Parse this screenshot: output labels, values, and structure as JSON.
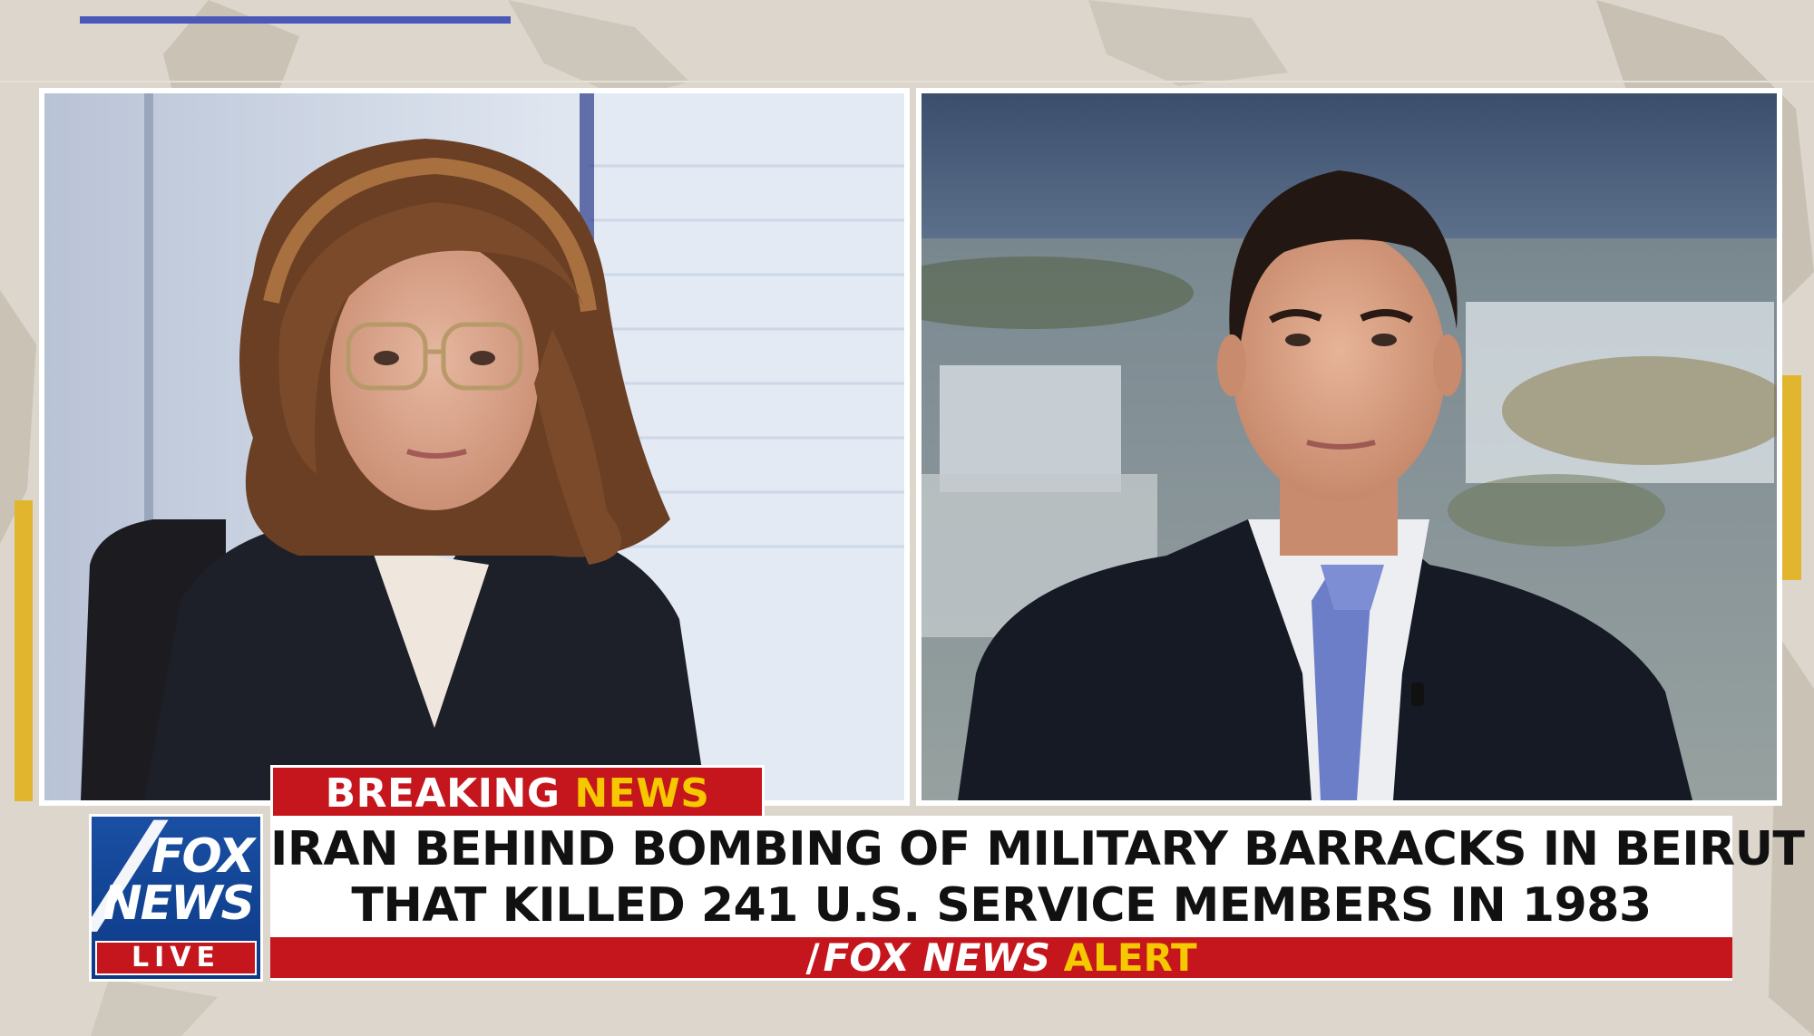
{
  "banner": {
    "breaking": "BREAKING",
    "news": "NEWS"
  },
  "headline": {
    "line1": "IRAN BEHIND BOMBING OF MILITARY BARRACKS IN BEIRUT",
    "line2": "THAT KILLED 241 U.S. SERVICE MEMBERS IN 1983"
  },
  "logo": {
    "fox": "FOX",
    "news": "NEWS",
    "live": "LIVE",
    "slash": "/"
  },
  "alert": {
    "prefix": "FOX NEWS",
    "word": "ALERT"
  },
  "colors": {
    "brand_red": "#c4161c",
    "brand_blue": "#1a4fa3",
    "accent_yellow": "#f5c800",
    "accent_stripe_blue": "#4a58b8"
  },
  "panels": {
    "left": {
      "subject": "anchor-woman"
    },
    "right": {
      "subject": "guest-man"
    }
  }
}
